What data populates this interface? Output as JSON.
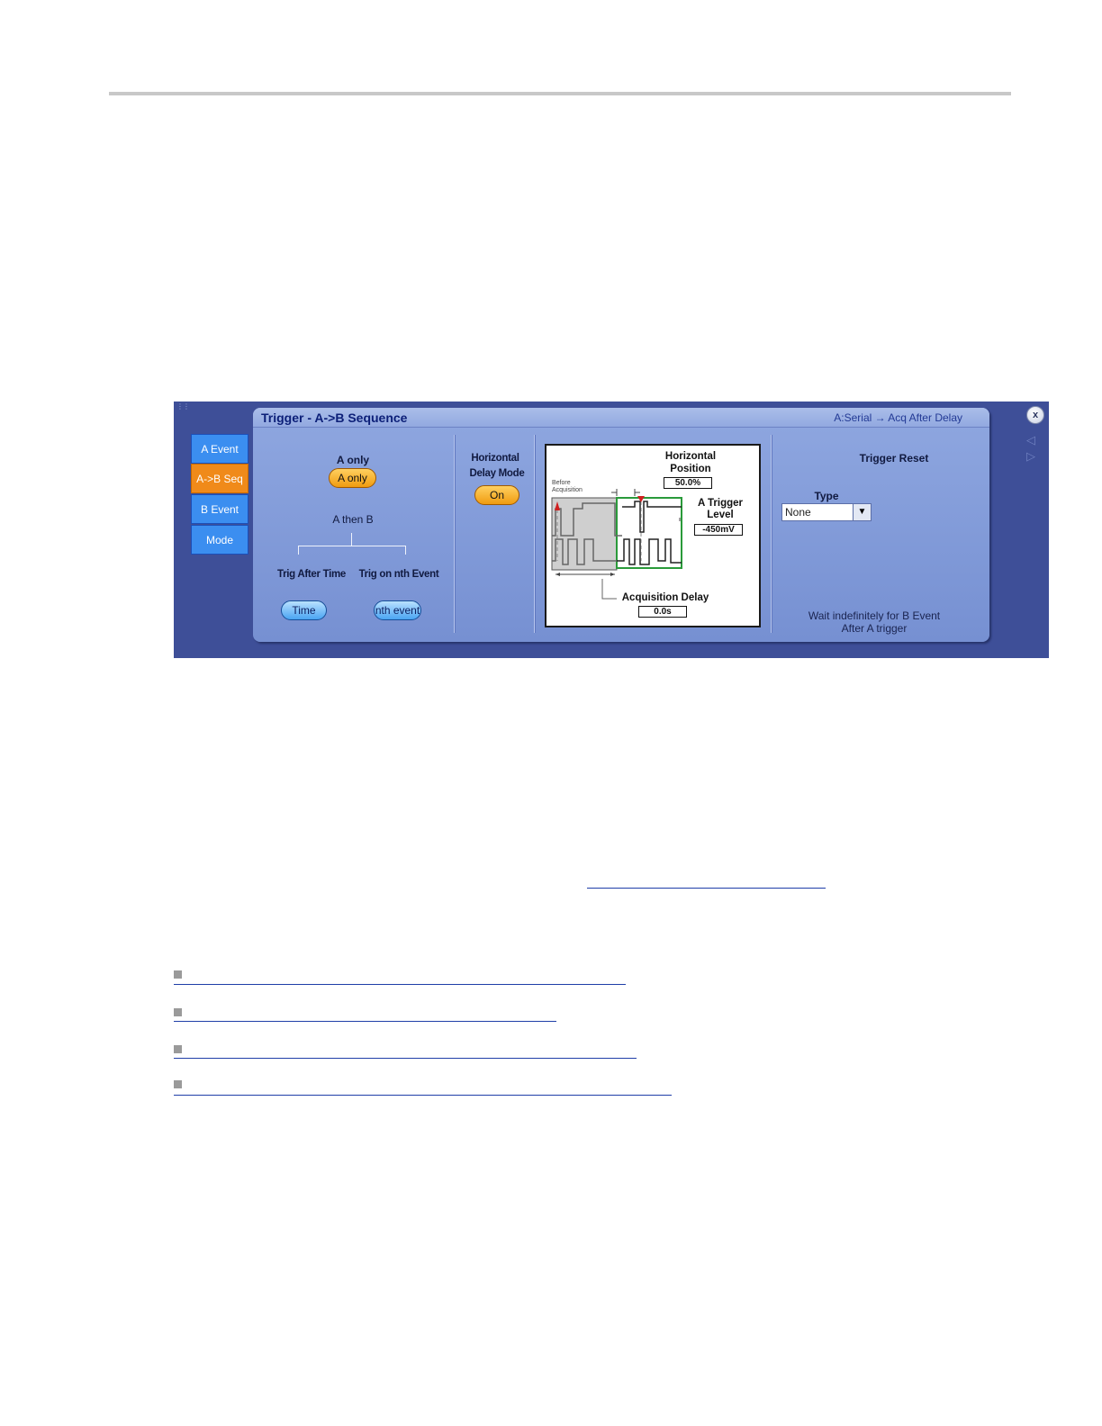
{
  "tabs": [
    {
      "label": "A Event",
      "active": false
    },
    {
      "label": "A->B Seq",
      "active": true
    },
    {
      "label": "B Event",
      "active": false
    },
    {
      "label": "Mode",
      "active": false
    }
  ],
  "panel": {
    "title": "Trigger - A->B Sequence",
    "status": "A:Serial → Acq After Delay"
  },
  "sequence": {
    "a_only_label": "A only",
    "a_only_button": "A only",
    "a_then_b_label": "A then B",
    "trig_after_time_label": "Trig After Time",
    "trig_nth_event_label": "Trig on nth Event",
    "time_button": "Time",
    "nth_event_button": "nth event"
  },
  "horizontal_delay": {
    "label_line1": "Horizontal",
    "label_line2": "Delay Mode",
    "button": "On"
  },
  "diagram": {
    "horizontal_position_label_line1": "Horizontal",
    "horizontal_position_label_line2": "Position",
    "horizontal_position_value": "50.0%",
    "before_acquisition_line1": "Before",
    "before_acquisition_line2": "Acquisition",
    "a_trigger_level_line1": "A Trigger",
    "a_trigger_level_line2": "Level",
    "a_trigger_level_value": "-450mV",
    "acquisition_delay_label": "Acquisition Delay",
    "acquisition_delay_value": "0.0s"
  },
  "trigger_reset": {
    "title": "Trigger Reset",
    "type_label": "Type",
    "type_value": "None",
    "message_line1": "Wait indefinitely for B Event",
    "message_line2": "After A trigger"
  },
  "window": {
    "close_label": "x"
  },
  "colors": {
    "frame": "#3e4f98",
    "tab_active": "#f08a1a",
    "tab_inactive": "#3b8ef0",
    "link": "#1f3ea8"
  }
}
